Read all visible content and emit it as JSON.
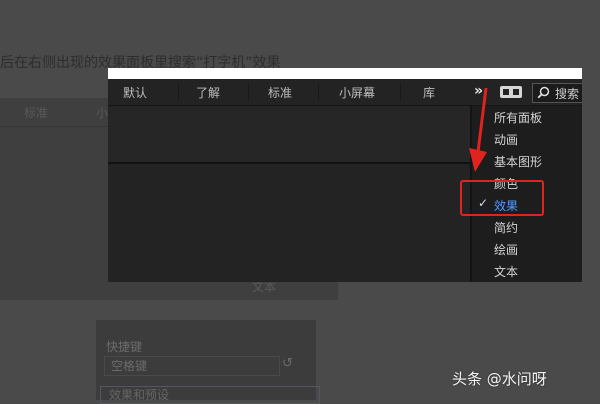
{
  "background": {
    "caption": "后在右侧出现的效果面板里搜索“打字机”效果",
    "tabs": [
      {
        "label": "标准"
      },
      {
        "label": "小"
      }
    ],
    "text_label": "文本",
    "shortcut_label": "快捷键",
    "shortcut_value": "空格键",
    "search_label": "效果和预设"
  },
  "toolbar": {
    "tabs": [
      {
        "label": "默认"
      },
      {
        "label": "了解"
      },
      {
        "label": "标准"
      },
      {
        "label": "小屏幕"
      },
      {
        "label": "库"
      }
    ],
    "more_icon": "»",
    "search_placeholder": "搜索"
  },
  "menu": {
    "items": [
      {
        "label": "所有面板",
        "checked": false
      },
      {
        "label": "动画",
        "checked": false
      },
      {
        "label": "基本图形",
        "checked": false
      },
      {
        "label": "颜色",
        "checked": false
      },
      {
        "label": "效果",
        "checked": true
      },
      {
        "label": "简约",
        "checked": false
      },
      {
        "label": "绘画",
        "checked": false
      },
      {
        "label": "文本",
        "checked": false
      }
    ],
    "check_glyph": "✓"
  },
  "colors": {
    "highlight": "#e0231f",
    "active_text": "#4f9dff"
  },
  "watermark": "头条 @水问呀"
}
